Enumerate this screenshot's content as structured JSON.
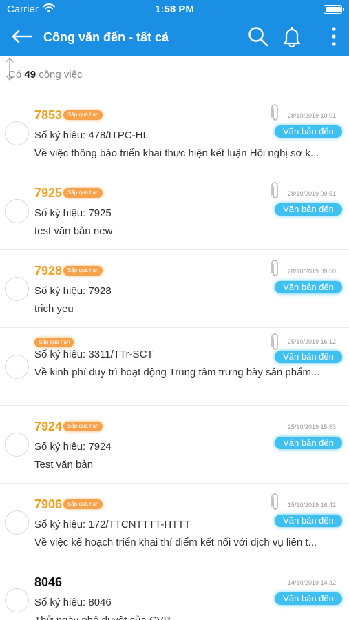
{
  "status_bar": {
    "carrier": "Carrier",
    "time": "1:58 PM"
  },
  "header": {
    "title": "Công văn đến - tất cả",
    "bg_color": "#1b8fe4"
  },
  "count": {
    "prefix": "Có",
    "value": "49",
    "suffix": "công việc"
  },
  "items": [
    {
      "number": "7853",
      "badge": "Sắp quá hạn",
      "ky_hieu": "Số ký hiệu: 478/ITPC-HL",
      "summary": "Về việc thông báo triển khai thực hiện kết luận Hội nghị sơ k...",
      "date": "28/10/2019 10:01",
      "type": "Văn bản đến"
    },
    {
      "number": "7925",
      "badge": "Sắp quá hạn",
      "ky_hieu": "Số ký hiệu: 7925",
      "summary": "test văn bản new",
      "date": "28/10/2019 09:51",
      "type": "Văn bản đến"
    },
    {
      "number": "7928",
      "badge": "Sắp quá hạn",
      "ky_hieu": "Số ký hiệu: 7928",
      "summary": "trich yeu",
      "date": "28/10/2019 09:50",
      "type": "Văn bản đến"
    },
    {
      "number": "",
      "badge": "Sắp quá hạn",
      "ky_hieu": "Số ký hiệu: 3311/TTr-SCT",
      "summary": "Về kinh phí duy trì hoạt động Trung tâm trưng bày sản phẩm...",
      "date": "25/10/2019 16:12",
      "type": "Văn bản đến"
    },
    {
      "number": "7924",
      "badge": "Sắp quá hạn",
      "ky_hieu": "Số ký hiệu: 7924",
      "summary": "Test văn bản",
      "date": "25/10/2019 15:53",
      "type": "Văn bản đến"
    },
    {
      "number": "7906",
      "badge": "Sắp quá hạn",
      "ky_hieu": "Số ký hiệu: 172/TTCNTTTT-HTTT",
      "summary": "Về việc kế hoạch triển khai thí điểm kết nối với dịch vụ liên t...",
      "date": "15/10/2019 16:42",
      "type": "Văn bản đến"
    },
    {
      "number": "8046",
      "badge": "",
      "ky_hieu": "Số ký hiệu: 8046",
      "summary": "Thử ngày phê duyệt của CVP",
      "date": "14/10/2019 14:32",
      "type": "Văn bản đến"
    }
  ]
}
